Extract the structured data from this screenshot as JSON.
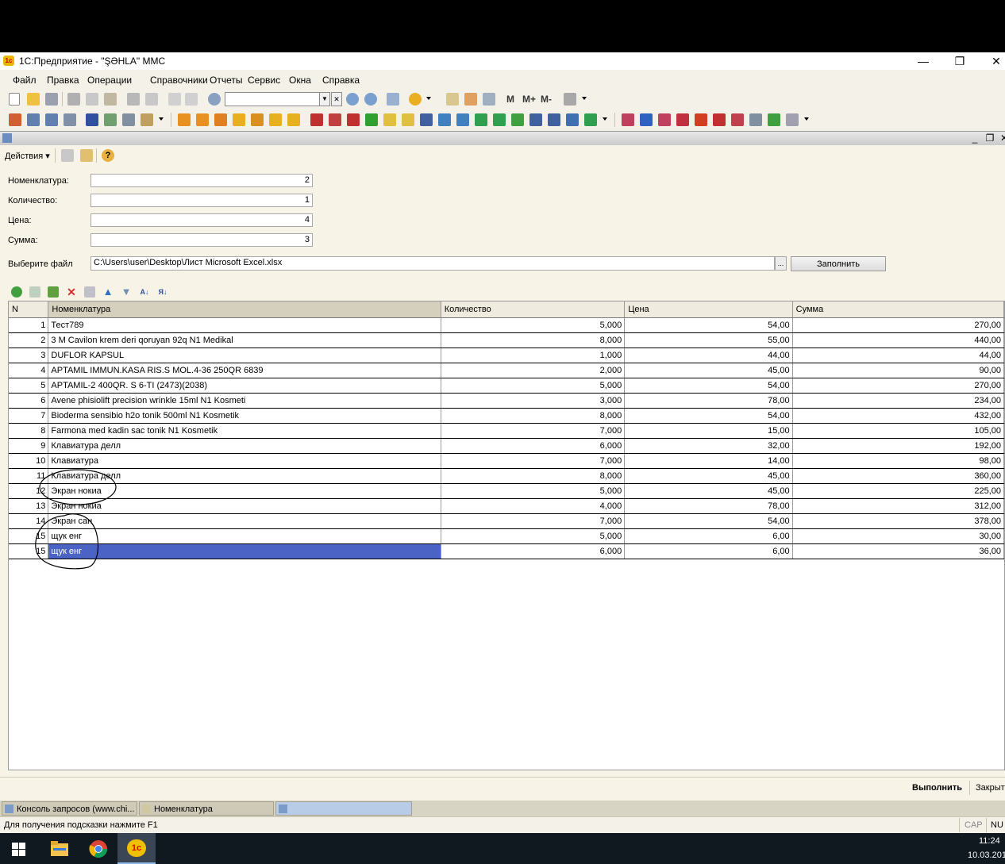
{
  "window": {
    "title": "1С:Предприятие - \"ŞƏHLA\" MMC",
    "app_icon": "1c-icon"
  },
  "menu": [
    "Файл",
    "Правка",
    "Операции",
    "Справочники",
    "Отчеты",
    "Сервис",
    "Окна",
    "Справка"
  ],
  "toolbar": {
    "m_buttons": [
      "M",
      "M+",
      "M-"
    ],
    "search_value": ""
  },
  "form": {
    "actions_label": "Действия",
    "fields": [
      {
        "label": "Номенклатура:",
        "value": "2"
      },
      {
        "label": "Количество:",
        "value": "1"
      },
      {
        "label": "Цена:",
        "value": "4"
      },
      {
        "label": "Сумма:",
        "value": "3"
      }
    ],
    "file_label": "Выберите файл",
    "file_path": "C:\\Users\\user\\Desktop\\Лист Microsoft Excel.xlsx",
    "browse_label": "...",
    "fill_button": "Заполнить"
  },
  "table": {
    "columns": [
      "N",
      "Номенклатура",
      "Количество",
      "Цена",
      "Сумма"
    ],
    "rows": [
      [
        "1",
        "Тест789",
        "5,000",
        "54,00",
        "270,00"
      ],
      [
        "2",
        "3 M Cavilon krem deri qoruyan 92q N1 Medikal",
        "8,000",
        "55,00",
        "440,00"
      ],
      [
        "3",
        "DUFLOR KAPSUL",
        "1,000",
        "44,00",
        "44,00"
      ],
      [
        "4",
        "APTAMIL IMMUN.KASA RIS.S MOL.4-36 250QR 6839",
        "2,000",
        "45,00",
        "90,00"
      ],
      [
        "5",
        "APTAMIL-2 400QR. S 6-TI (2473)(2038)",
        "5,000",
        "54,00",
        "270,00"
      ],
      [
        "6",
        "Avene phisiolift precision wrinkle 15ml N1 Kosmeti",
        "3,000",
        "78,00",
        "234,00"
      ],
      [
        "7",
        "Bioderma sensibio h2o tonik 500ml N1 Kosmetik",
        "8,000",
        "54,00",
        "432,00"
      ],
      [
        "8",
        "Farmona med kadin sac tonik  N1 Kosmetik",
        "7,000",
        "15,00",
        "105,00"
      ],
      [
        "9",
        "Клавиатура делл",
        "6,000",
        "32,00",
        "192,00"
      ],
      [
        "10",
        "Клавиатура",
        "7,000",
        "14,00",
        "98,00"
      ],
      [
        "11",
        "Клавиатура делл",
        "8,000",
        "45,00",
        "360,00"
      ],
      [
        "12",
        "Экран нокиа",
        "5,000",
        "45,00",
        "225,00"
      ],
      [
        "13",
        "Экран нокиа",
        "4,000",
        "78,00",
        "312,00"
      ],
      [
        "14",
        "Экран сан",
        "7,000",
        "54,00",
        "378,00"
      ],
      [
        "15",
        "щук енг",
        "5,000",
        "6,00",
        "30,00"
      ],
      [
        "16",
        "щук енг",
        "6,000",
        "6,00",
        "36,00"
      ]
    ],
    "row_numbers_displayed": [
      "1",
      "2",
      "3",
      "4",
      "5",
      "6",
      "7",
      "8",
      "9",
      "10",
      "11",
      "12",
      "13",
      "14",
      "15",
      "15"
    ],
    "selected_row": 16
  },
  "bottom_actions": {
    "execute": "Выполнить",
    "close": "Закрыть"
  },
  "tasks": [
    {
      "label": "Консоль запросов (www.chi..."
    },
    {
      "label": "Номенклатура"
    },
    {
      "label": ""
    }
  ],
  "statusbar": {
    "hint": "Для получения подсказки нажмите F1",
    "cap": "CAP",
    "num": "NU"
  },
  "taskbar": {
    "time": "11:24",
    "date": "10.03.201"
  },
  "colors": {
    "selection": "#4a63c4",
    "form_bg": "#f7f3e6",
    "toolbar_bg": "#f3f1e8",
    "taskbar_bg": "#101820"
  }
}
